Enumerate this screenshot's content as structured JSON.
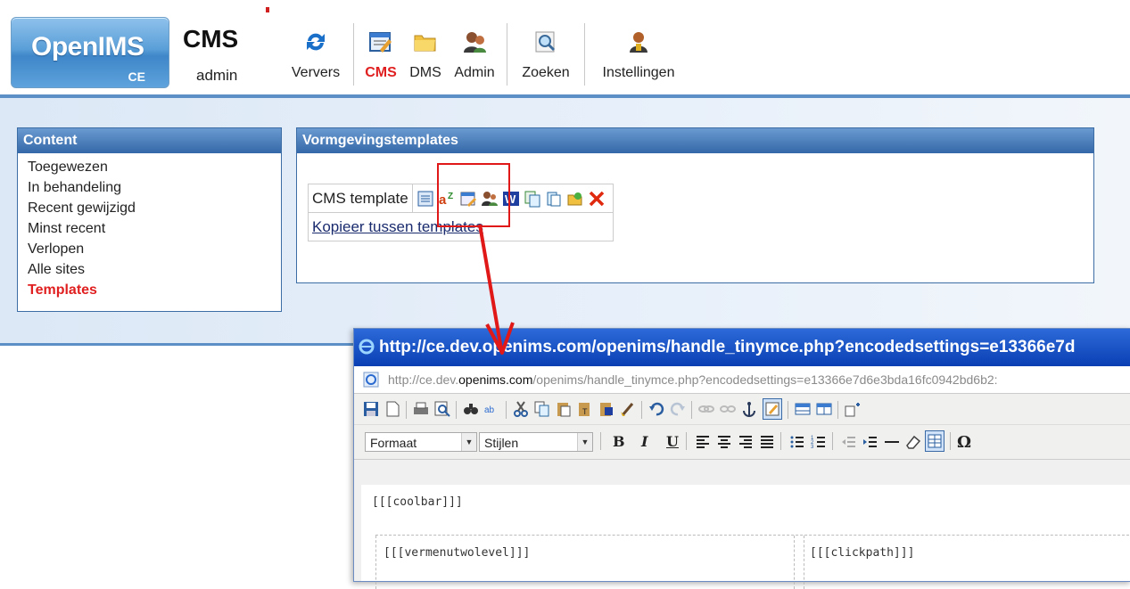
{
  "header": {
    "logo_text": "OpenIMS",
    "logo_sub": "CE",
    "app_title": "CMS",
    "app_user": "admin",
    "toolbar": [
      {
        "label": "Ververs",
        "icon": "refresh-icon"
      },
      {
        "label": "CMS",
        "icon": "cms-icon",
        "active": true
      },
      {
        "label": "DMS",
        "icon": "folder-icon"
      },
      {
        "label": "Admin",
        "icon": "admin-user-icon"
      },
      {
        "label": "Zoeken",
        "icon": "search-icon"
      },
      {
        "label": "Instellingen",
        "icon": "settings-user-icon"
      }
    ]
  },
  "content_panel": {
    "title": "Content",
    "items": [
      {
        "label": "Toegewezen"
      },
      {
        "label": "In behandeling"
      },
      {
        "label": "Recent gewijzigd"
      },
      {
        "label": "Minst recent"
      },
      {
        "label": "Verlopen"
      },
      {
        "label": "Alle sites"
      },
      {
        "label": "Templates",
        "active": true
      }
    ]
  },
  "templates_panel": {
    "title": "Vormgevingstemplates",
    "row_label": "CMS template",
    "copy_link": "Kopieer tussen templates",
    "icons": [
      "list-icon",
      "translate-icon",
      "edit-page-icon",
      "users-icon",
      "word-icon",
      "copy-icon",
      "paste-icon",
      "export-icon",
      "delete-icon"
    ]
  },
  "popup": {
    "title": "http://ce.dev.openims.com/openims/handle_tinymce.php?encodedsettings=e13366e7d",
    "address_prefix": "http://ce.dev.",
    "address_domain": "openims.com",
    "address_suffix": "/openims/handle_tinymce.php?encodedsettings=e13366e7d6e3bda16fc0942bd6b2:",
    "format_select": "Formaat",
    "styles_select": "Stijlen",
    "content": {
      "coolbar": "[[[coolbar]]]",
      "vermenu": "[[[vermenutwolevel]]]",
      "clickpath": "[[[clickpath]]]"
    }
  },
  "colors": {
    "accent_blue": "#3468a8",
    "active_red": "#e02020",
    "title_bar": "#0a3fb4"
  }
}
